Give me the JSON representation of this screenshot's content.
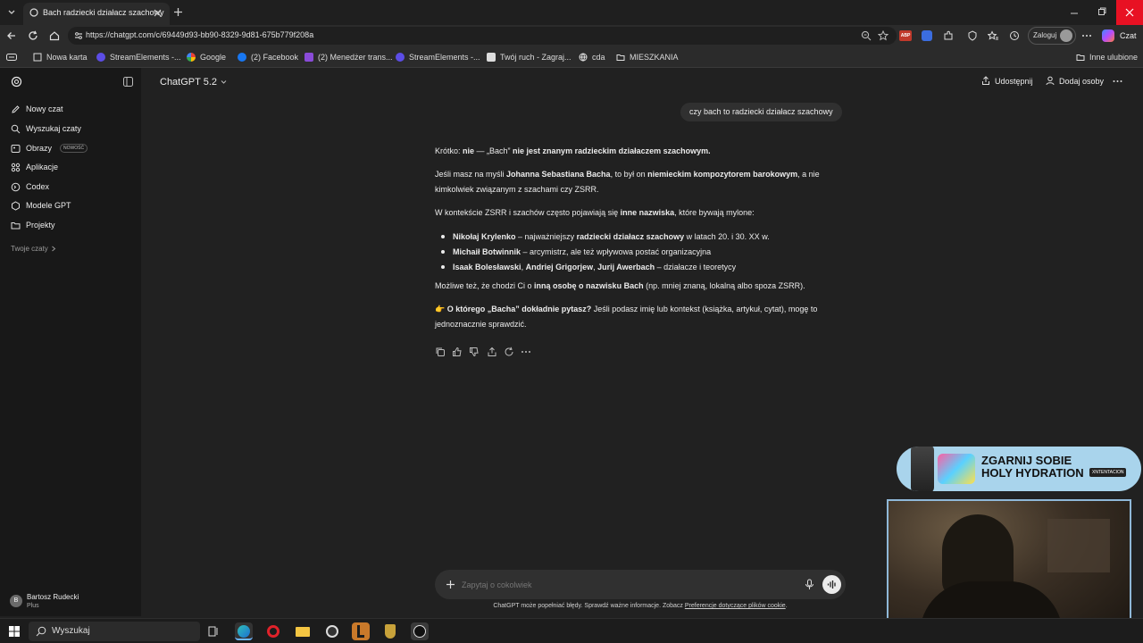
{
  "browser": {
    "tab_title": "Bach radziecki działacz szachowy",
    "url": "https://chatgpt.com/c/69449d93-bb90-8329-9d81-675b779f208a",
    "login_label": "Zaloguj",
    "copilot_label": "Czat",
    "bookmarks": [
      "Nowa karta",
      "StreamElements -...",
      "Google",
      "(2) Facebook",
      "(2) Menedżer trans...",
      "StreamElements -...",
      "Twój ruch - Zagraj...",
      "cda",
      "MIESZKANIA"
    ],
    "other_favorites": "Inne ulubione"
  },
  "sidebar": {
    "items": [
      {
        "label": "Nowy czat",
        "icon": "edit-icon"
      },
      {
        "label": "Wyszukaj czaty",
        "icon": "search-icon"
      },
      {
        "label": "Obrazy",
        "icon": "image-icon",
        "badge": "NOWOŚĆ"
      },
      {
        "label": "Aplikacje",
        "icon": "apps-icon"
      },
      {
        "label": "Codex",
        "icon": "codex-icon"
      },
      {
        "label": "Modele GPT",
        "icon": "gpt-models-icon"
      },
      {
        "label": "Projekty",
        "icon": "folder-icon"
      }
    ],
    "section_label": "Twoje czaty",
    "user": {
      "initial": "B",
      "name": "Bartosz Rudecki",
      "plan": "Plus"
    }
  },
  "header": {
    "model": "ChatGPT 5.2",
    "share_label": "Udostępnij",
    "add_people_label": "Dodaj osoby"
  },
  "conversation": {
    "user_message": "czy bach to radziecki działacz szachowy",
    "answer": {
      "p1": {
        "a": "Krótko: ",
        "b": "nie",
        "c": " — „Bach” ",
        "d": "nie jest znanym radzieckim działaczem szachowym."
      },
      "p2": {
        "a": "Jeśli masz na myśli ",
        "b": "Johanna Sebastiana Bacha",
        "c": ", to był on ",
        "d": "niemieckim kompozytorem barokowym",
        "e": ", a nie kimkolwiek związanym z szachami czy ZSRR."
      },
      "p3": {
        "a": "W kontekście ZSRR i szachów często pojawiają się ",
        "b": "inne nazwiska",
        "c": ", które bywają mylone:"
      },
      "bullets": [
        {
          "a": "Nikołaj Krylenko",
          "b": " – najważniejszy ",
          "c": "radziecki działacz szachowy",
          "d": " w latach 20. i 30. XX w."
        },
        {
          "a": "Michaił Botwinnik",
          "b": " – arcymistrz, ale też wpływowa postać organizacyjna"
        },
        {
          "a": "Isaak Bolesławski",
          "b": ", ",
          "c": "Andriej Grigorjew",
          "d": ", ",
          "e": "Jurij Awerbach",
          "f": " – działacze i teoretycy"
        }
      ],
      "p4": {
        "a": "Możliwe też, że chodzi Ci o ",
        "b": "inną osobę o nazwisku Bach",
        "c": " (np. mniej znaną, lokalną albo spoza ZSRR)."
      },
      "p5": {
        "emoji": "👉",
        "b": "O którego „Bacha” dokładnie pytasz?",
        "c": " Jeśli podasz imię lub kontekst (książka, artykuł, cytat), mogę to jednoznacznie sprawdzić."
      }
    }
  },
  "composer": {
    "placeholder": "Zapytaj o cokolwiek",
    "disclaimer": "ChatGPT może popełniać błędy. Sprawdź ważne informacje. Zobacz ",
    "disclaimer_link": "Preferencje dotyczące plików cookie",
    "disclaimer_end": "."
  },
  "overlay_ad": {
    "line1": "ZGARNIJ SOBIE",
    "line2": "HOLY HYDRATION",
    "brand": "XNTENTACION"
  },
  "taskbar": {
    "search_label": "Wyszukaj"
  },
  "colors": {
    "bg": "#212121",
    "sidebar": "#181818",
    "bubble": "#303030",
    "text": "#ececec",
    "close_red": "#e81123"
  }
}
